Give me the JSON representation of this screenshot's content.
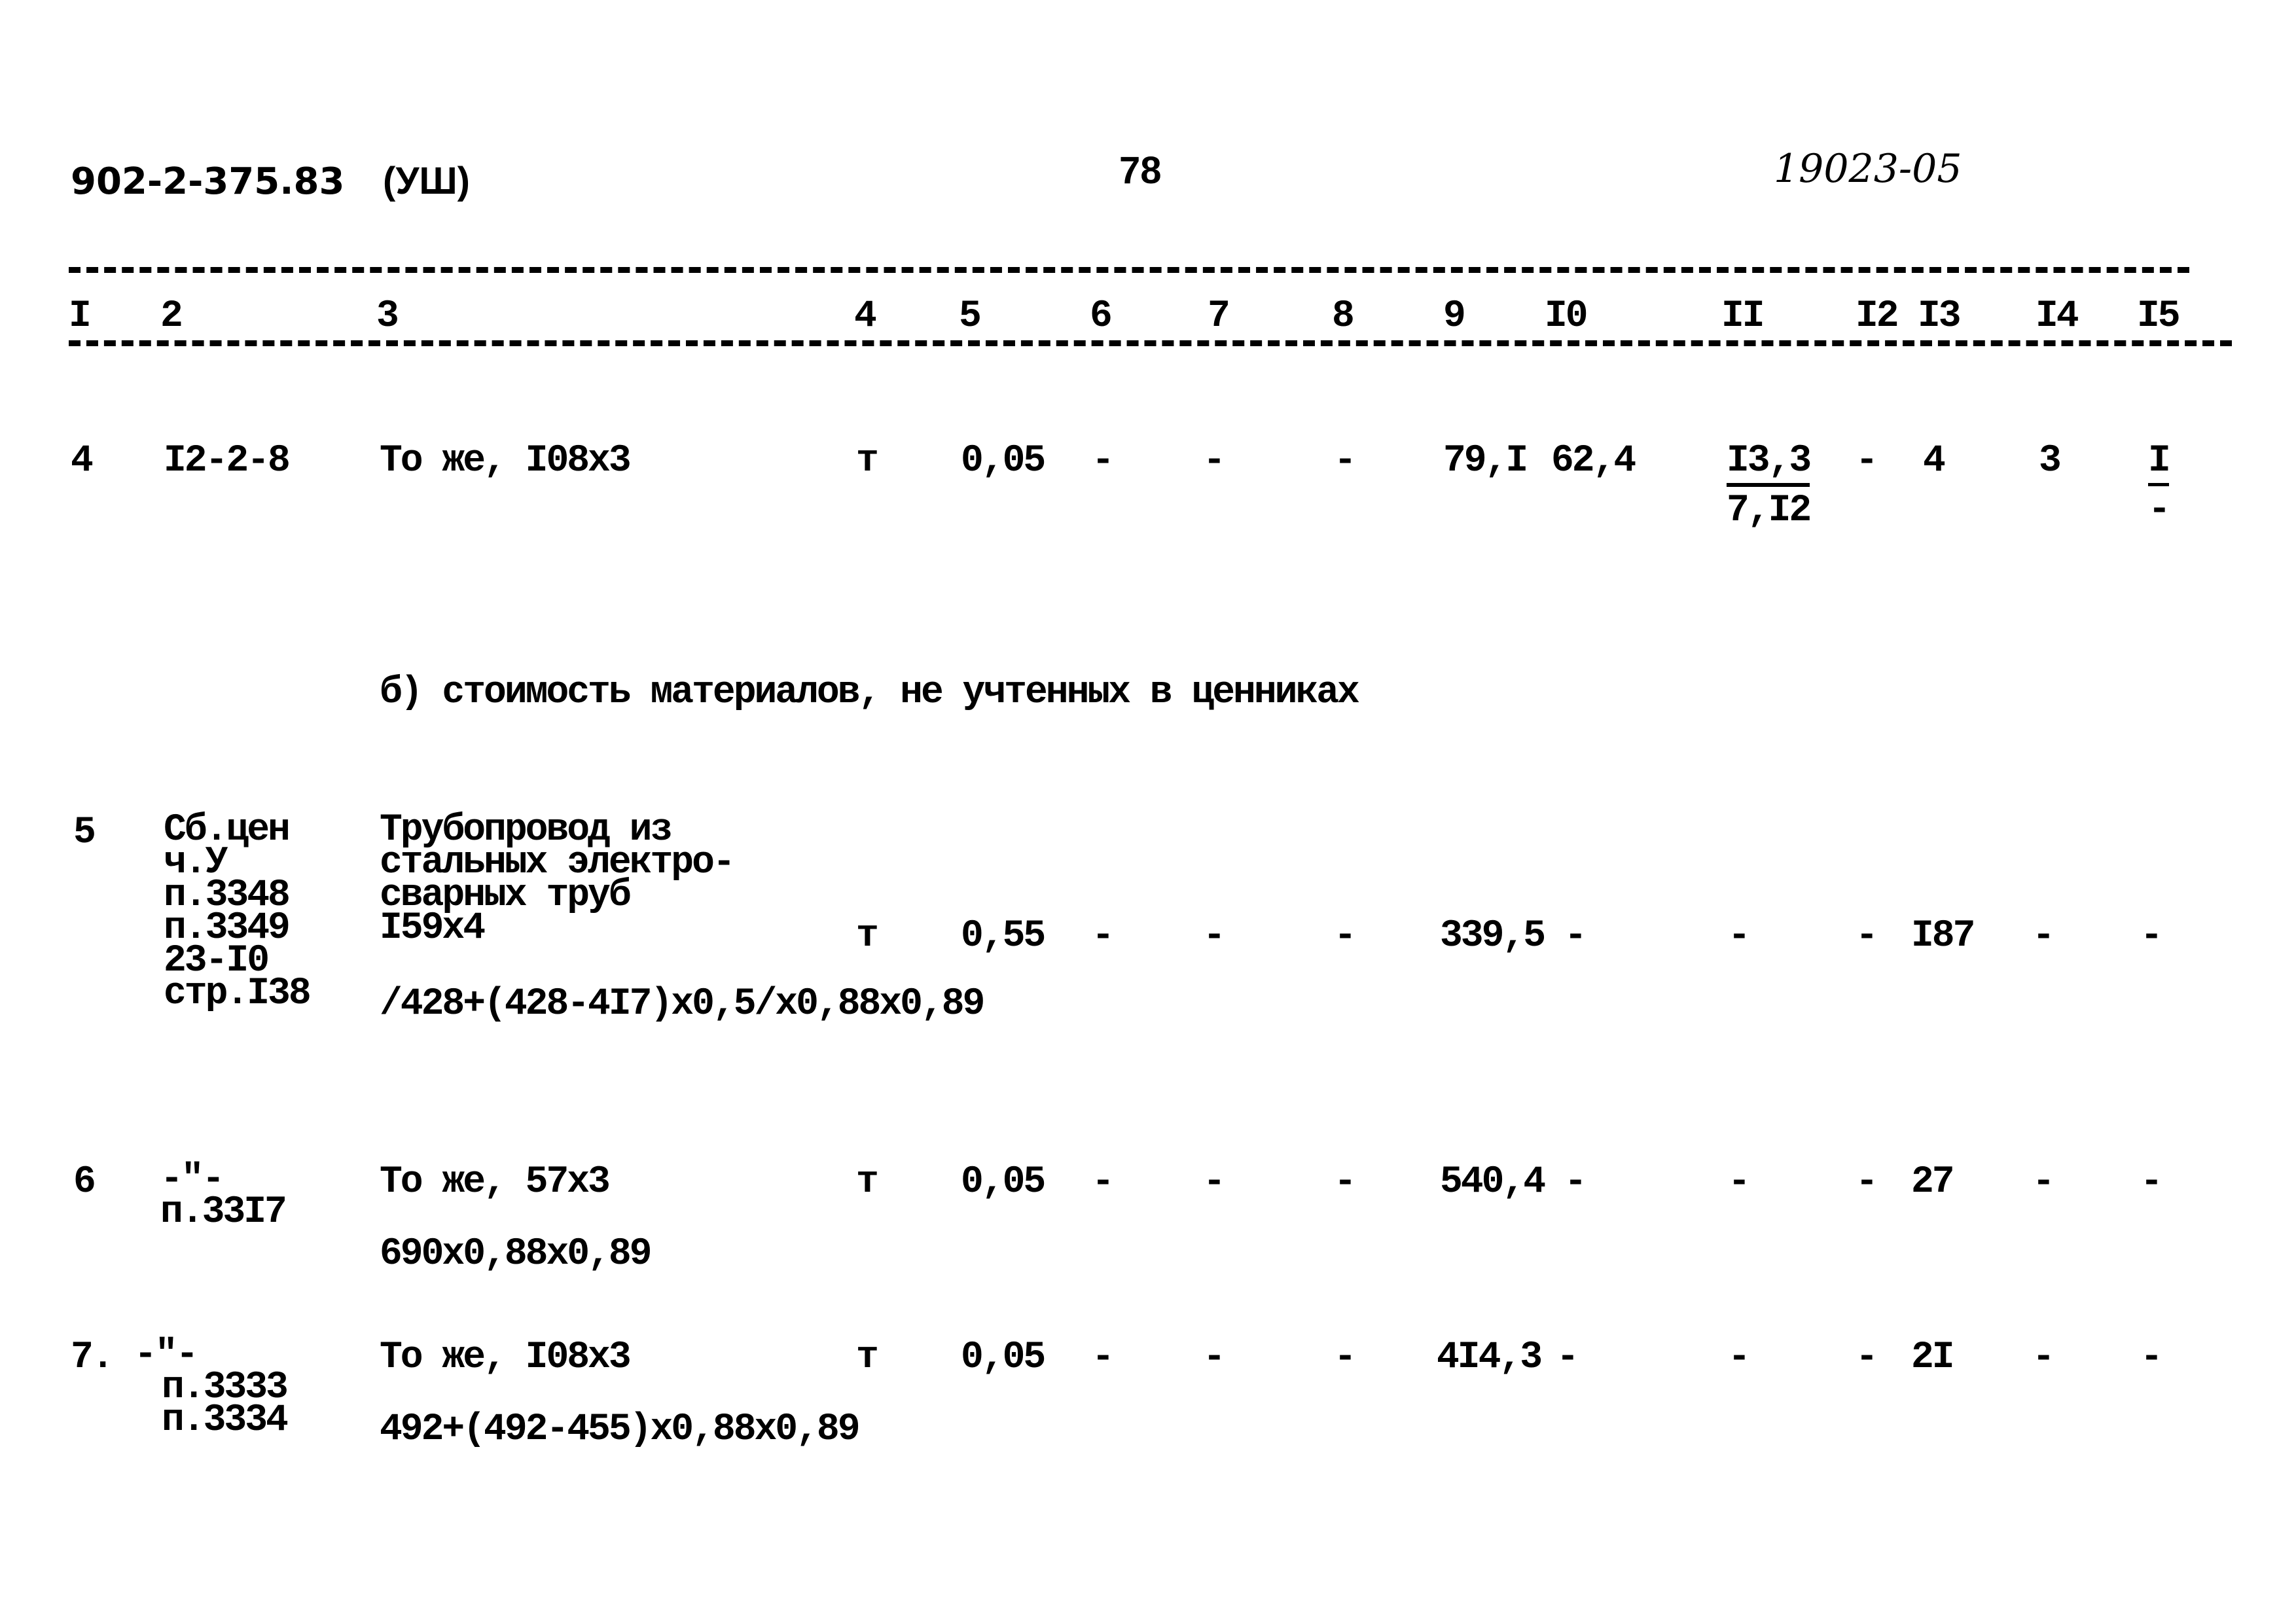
{
  "header": {
    "project_code": "902-2-375.83",
    "section_label": "(УШ)",
    "page_number": "78",
    "archive_number": "19023-05"
  },
  "table": {
    "column_numbers": [
      "I",
      "2",
      "3",
      "4",
      "5",
      "6",
      "7",
      "8",
      "9",
      "I0",
      "II",
      "I2",
      "I3",
      "I4",
      "I5"
    ],
    "rows_a": [
      {
        "n": "4",
        "code": [
          "I2-2-8"
        ],
        "name": [
          "То же, I08x3"
        ],
        "unit": "т",
        "c5": "0,05",
        "c6": "-",
        "c7": "-",
        "c8": "-",
        "c9": "79,I",
        "c10": "62,4",
        "c11": {
          "numerator": "I3,3",
          "denominator": "7,I2"
        },
        "c12": "-",
        "c13": "4",
        "c14": "3",
        "c15": {
          "numerator": "I",
          "denominator": "-"
        }
      }
    ],
    "section_b_heading": "б) стоимость материалов, не учтенных в ценниках",
    "rows_b": [
      {
        "n": "5",
        "code": [
          "Сб.цен",
          "ч.У",
          "п.3348",
          "п.3349",
          "23-I0",
          "стр.I38"
        ],
        "name": [
          "Трубопровод из",
          "стальных электро-",
          "сварных труб",
          "I59x4"
        ],
        "formula": "/428+(428-4I7)x0,5/x0,88x0,89",
        "unit": "т",
        "c5": "0,55",
        "c6": "-",
        "c7": "-",
        "c8": "-",
        "c9": "339,5",
        "c10": "-",
        "c11": "-",
        "c12": "-",
        "c13": "I87",
        "c14": "-",
        "c15": "-"
      },
      {
        "n": "6",
        "code": [
          "-\"-",
          "п.33I7"
        ],
        "name": [
          "То же, 57x3"
        ],
        "formula": "690x0,88x0,89",
        "unit": "т",
        "c5": "0,05",
        "c6": "-",
        "c7": "-",
        "c8": "-",
        "c9": "540,4",
        "c10": "-",
        "c11": "-",
        "c12": "-",
        "c13": "27",
        "c14": "-",
        "c15": "-"
      },
      {
        "n": "7.",
        "code": [
          "-\"-",
          "п.3333",
          "п.3334"
        ],
        "name": [
          "То же, I08x3"
        ],
        "formula": "492+(492-455)x0,88x0,89",
        "unit": "т",
        "c5": "0,05",
        "c6": "-",
        "c7": "-",
        "c8": "-",
        "c9": "4I4,3",
        "c10": "-",
        "c11": "-",
        "c12": "-",
        "c13": "2I",
        "c14": "-",
        "c15": "-"
      }
    ]
  }
}
